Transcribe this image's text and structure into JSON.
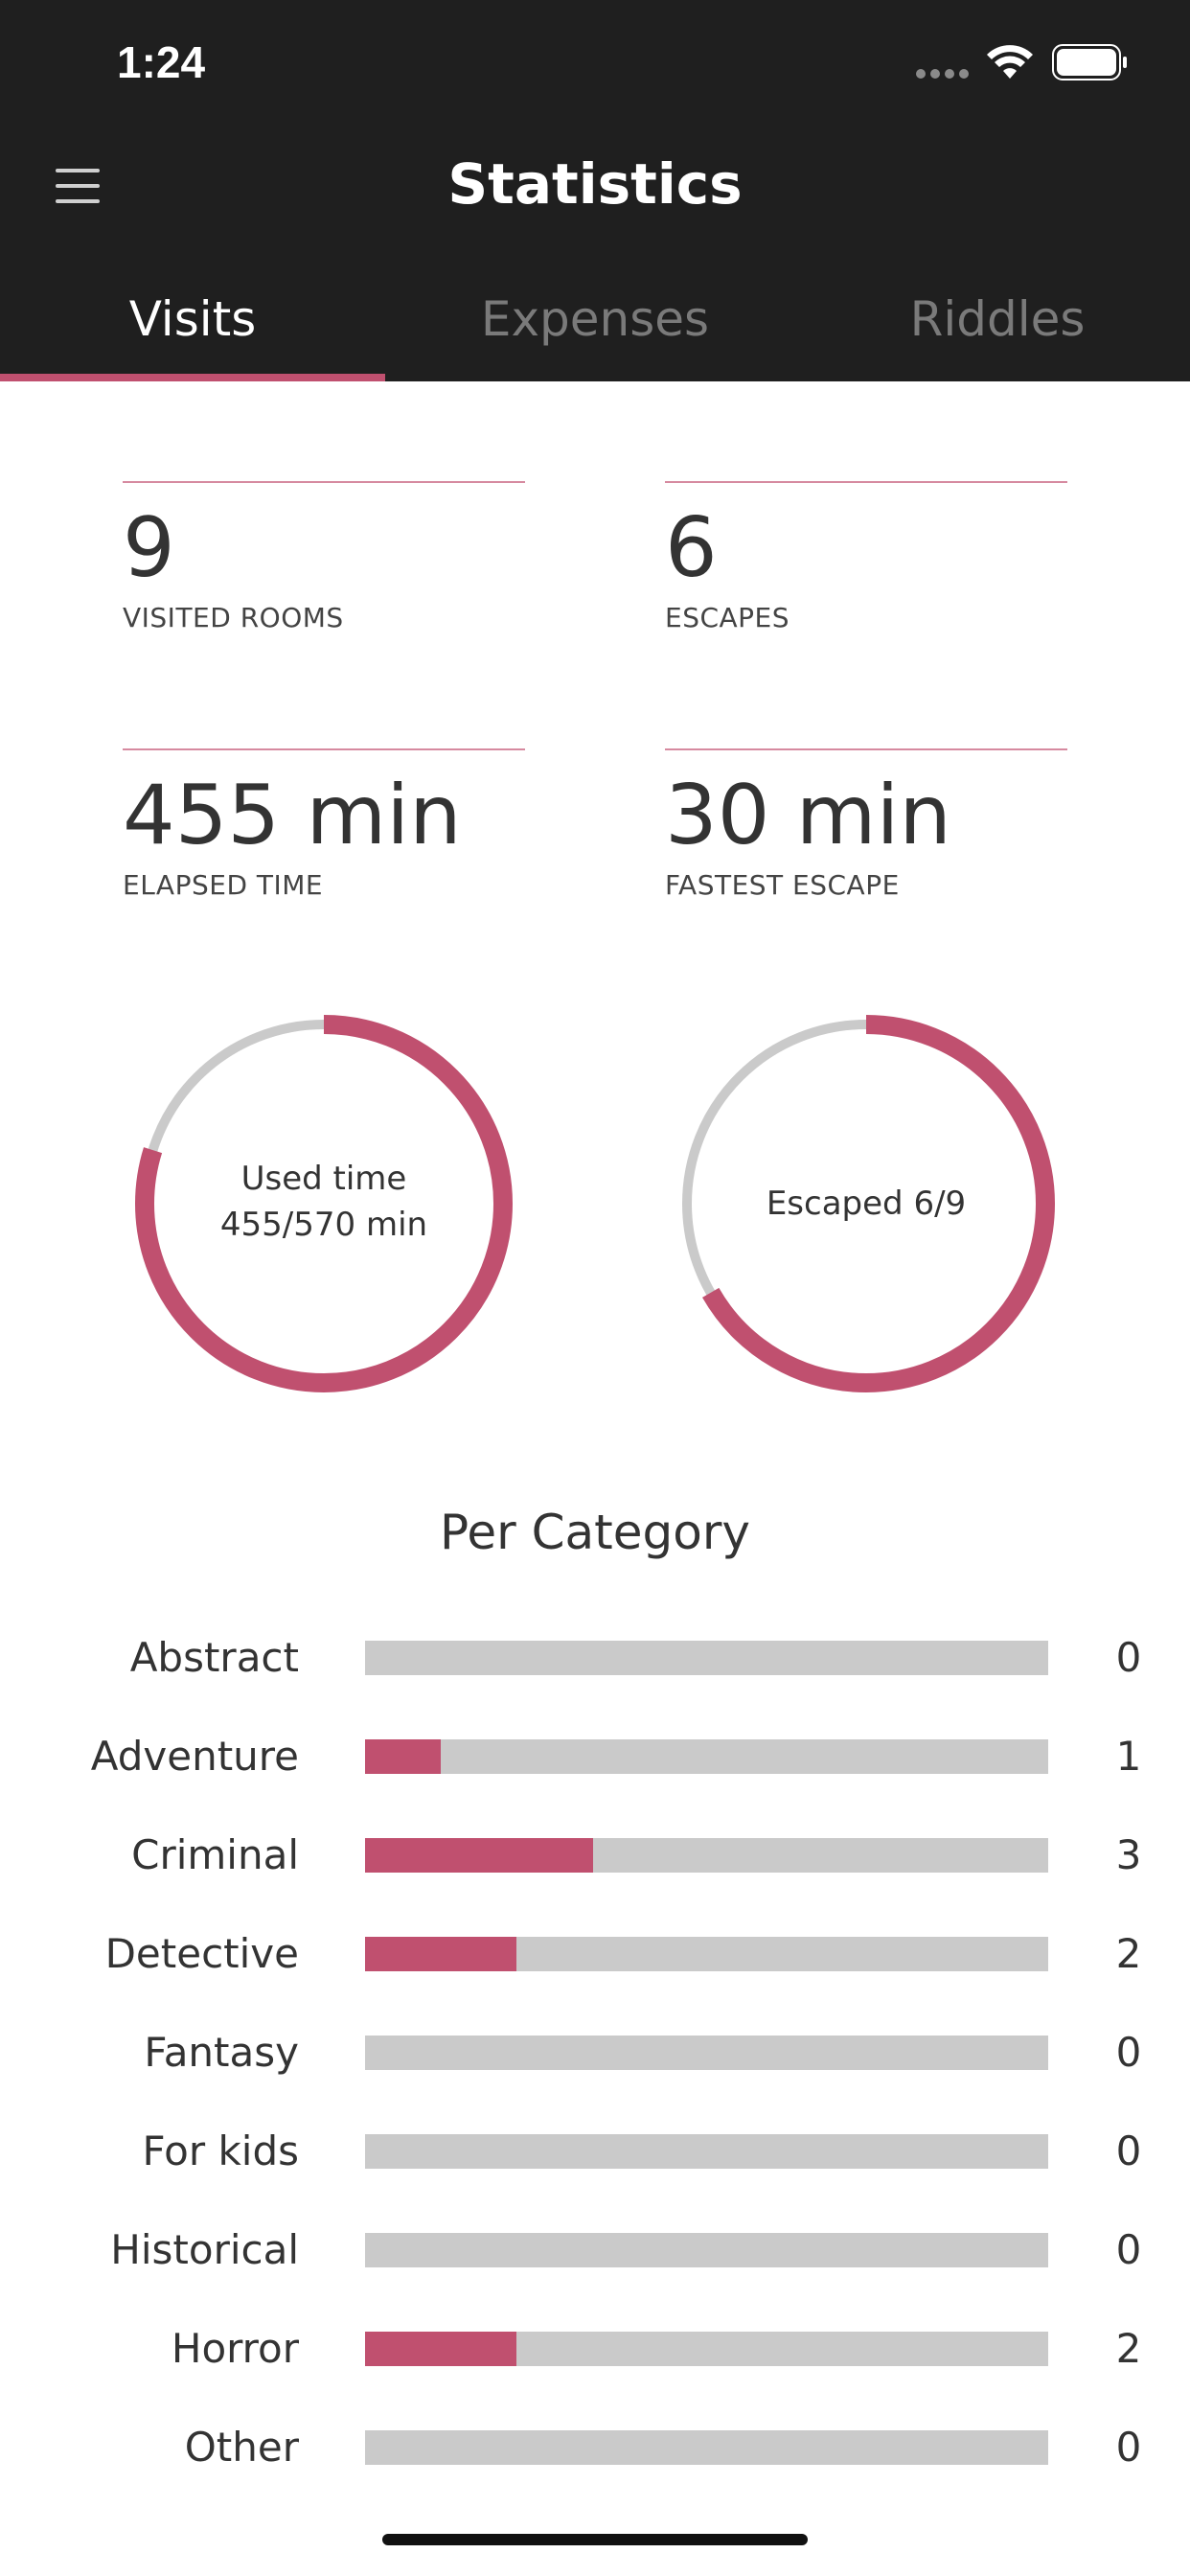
{
  "status_bar": {
    "time": "1:24"
  },
  "header": {
    "title": "Statistics",
    "menu_icon": "hamburger-menu-icon"
  },
  "tabs": [
    {
      "label": "Visits",
      "active": true
    },
    {
      "label": "Expenses",
      "active": false
    },
    {
      "label": "Riddles",
      "active": false
    }
  ],
  "stats": [
    {
      "value": "9",
      "label": "VISITED ROOMS"
    },
    {
      "value": "6",
      "label": "ESCAPES"
    },
    {
      "value": "455 min",
      "label": "ELAPSED TIME"
    },
    {
      "value": "30 min",
      "label": "FASTEST ESCAPE"
    }
  ],
  "rings": [
    {
      "line1": "Used time",
      "line2": "455/570 min",
      "fraction": 0.798
    },
    {
      "line1": "Escaped 6/9",
      "fraction": 0.667
    }
  ],
  "colors": {
    "accent": "#c0506f",
    "track": "#cacaca",
    "header_bg": "#1f1f1f"
  },
  "per_category": {
    "title": "Per Category",
    "max": 9,
    "items": [
      {
        "label": "Abstract",
        "count": "0",
        "value": 0
      },
      {
        "label": "Adventure",
        "count": "1",
        "value": 1
      },
      {
        "label": "Criminal",
        "count": "3",
        "value": 3
      },
      {
        "label": "Detective",
        "count": "2",
        "value": 2
      },
      {
        "label": "Fantasy",
        "count": "0",
        "value": 0
      },
      {
        "label": "For kids",
        "count": "0",
        "value": 0
      },
      {
        "label": "Historical",
        "count": "0",
        "value": 0
      },
      {
        "label": "Horror",
        "count": "2",
        "value": 2
      },
      {
        "label": "Other",
        "count": "0",
        "value": 0
      }
    ]
  }
}
